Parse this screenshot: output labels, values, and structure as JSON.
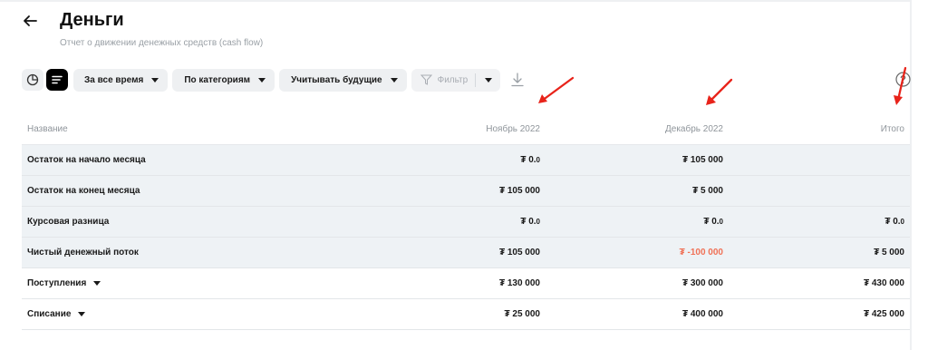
{
  "header": {
    "title": "Деньги",
    "subtitle": "Отчет о движении денежных средств (cash flow)"
  },
  "toolbar": {
    "period_label": "За все время",
    "grouping_label": "По категориям",
    "future_label": "Учитывать будущие",
    "filter_label": "Фильтр"
  },
  "table": {
    "columns": [
      "Название",
      "Ноябрь 2022",
      "Декабрь 2022",
      "Итого"
    ],
    "rows": [
      {
        "name": "Остаток на начало месяца",
        "nov": "₮ 0.",
        "nov_dec": "0",
        "dec": "₮ 105 000",
        "total": "",
        "style": "shade"
      },
      {
        "name": "Остаток на конец месяца",
        "nov": "₮ 105 000",
        "dec": "₮ 5 000",
        "total": "",
        "style": "shade"
      },
      {
        "name": "Курсовая разница",
        "nov": "₮ 0.",
        "nov_dec": "0",
        "dec": "₮ 0.",
        "dec_dec": "0",
        "total": "₮ 0.",
        "total_dec": "0",
        "style": "shade"
      },
      {
        "name": "Чистый денежный поток",
        "nov": "₮ 105 000",
        "dec": "₮ -100 000",
        "total": "₮ 5 000",
        "style": "shade",
        "dec_negative": true
      },
      {
        "name": "Поступления",
        "nov": "₮ 130 000",
        "dec": "₮ 300 000",
        "total": "₮ 430 000",
        "style": "plain",
        "expandable": true
      },
      {
        "name": "Списание",
        "nov": "₮ 25 000",
        "dec": "₮ 400 000",
        "total": "₮ 425 000",
        "style": "plain",
        "expandable": true
      }
    ]
  },
  "colors": {
    "negative": "#f07156",
    "row_shade": "#eef2f5",
    "annotation_arrow": "#e8231a"
  },
  "icons": [
    "back-arrow-icon",
    "pie-chart-icon",
    "list-icon",
    "filter-icon",
    "download-icon",
    "help-icon"
  ]
}
